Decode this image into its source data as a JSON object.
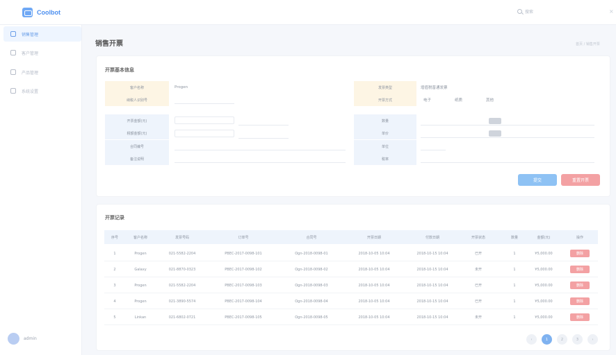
{
  "app": {
    "name": "Coolbot"
  },
  "topbar": {
    "search_placeholder": "搜索"
  },
  "sidebar": {
    "items": [
      {
        "label": "销售管理",
        "active": true
      },
      {
        "label": "客户管理",
        "active": false
      },
      {
        "label": "产品管理",
        "active": false
      },
      {
        "label": "系统设置",
        "active": false
      }
    ]
  },
  "user": {
    "name": "admin"
  },
  "page": {
    "title": "销售开票",
    "breadcrumb": "首页 / 销售开票"
  },
  "form": {
    "title": "开票基本信息",
    "labels": {
      "customer": "客户名称",
      "tax_no": "纳税人识别号",
      "invoice_type": "发票类型",
      "invoice_kind": "开票方式",
      "amount_a": "开票金额(元)",
      "amount_b": "税额金额(元)",
      "contract_no": "合同编号",
      "remark": "备注说明",
      "qty": "数量",
      "price": "单价",
      "unit": "单位",
      "tax": "税率"
    },
    "values": {
      "customer": "Progen",
      "invoice_type": "增值税普通发票",
      "option_a": "电子",
      "option_b": "纸质",
      "option_c": "其他"
    },
    "buttons": {
      "submit": "提交",
      "reset": "重置开票"
    }
  },
  "table": {
    "title": "开票记录",
    "columns": [
      "序号",
      "客户名称",
      "发票号码",
      "订单号",
      "合同号",
      "开票日期",
      "付款日期",
      "开票状态",
      "数量",
      "金额(元)",
      "操作"
    ],
    "rows": [
      [
        "1",
        "Progen",
        "021-5582-2204",
        "PBEC-2017-0098-101",
        "Ogn-2018-0098-01",
        "2018-10-05 10:04",
        "2018-10-15 10:04",
        "已开",
        "1",
        "¥5,000.00",
        "删除"
      ],
      [
        "2",
        "Galaxy",
        "021-8870-0323",
        "PBEC-2017-0098-102",
        "Ogn-2018-0098-02",
        "2018-10-05 10:04",
        "2018-10-15 10:04",
        "未开",
        "1",
        "¥5,000.00",
        "删除"
      ],
      [
        "3",
        "Progen",
        "021-5582-2204",
        "PBEC-2017-0098-103",
        "Ogn-2018-0098-03",
        "2018-10-05 10:04",
        "2018-10-15 10:04",
        "已开",
        "1",
        "¥5,000.00",
        "删除"
      ],
      [
        "4",
        "Progen",
        "021-3890-5574",
        "PBEC-2017-0098-104",
        "Ogn-2018-0098-04",
        "2018-10-05 10:04",
        "2018-10-15 10:04",
        "已开",
        "1",
        "¥5,000.00",
        "删除"
      ],
      [
        "5",
        "Linkan",
        "021-6802-0721",
        "PBEC-2017-0098-105",
        "Ogn-2018-0098-05",
        "2018-10-05 10:04",
        "2018-10-15 10:04",
        "未开",
        "1",
        "¥5,000.00",
        "删除"
      ]
    ]
  },
  "pagination": {
    "pages": [
      "‹",
      "1",
      "2",
      "3",
      "›"
    ],
    "current": "1"
  },
  "colors": {
    "accent": "#7fb2f0",
    "danger": "#f3a1a3",
    "brand": "#4c8ff0"
  }
}
